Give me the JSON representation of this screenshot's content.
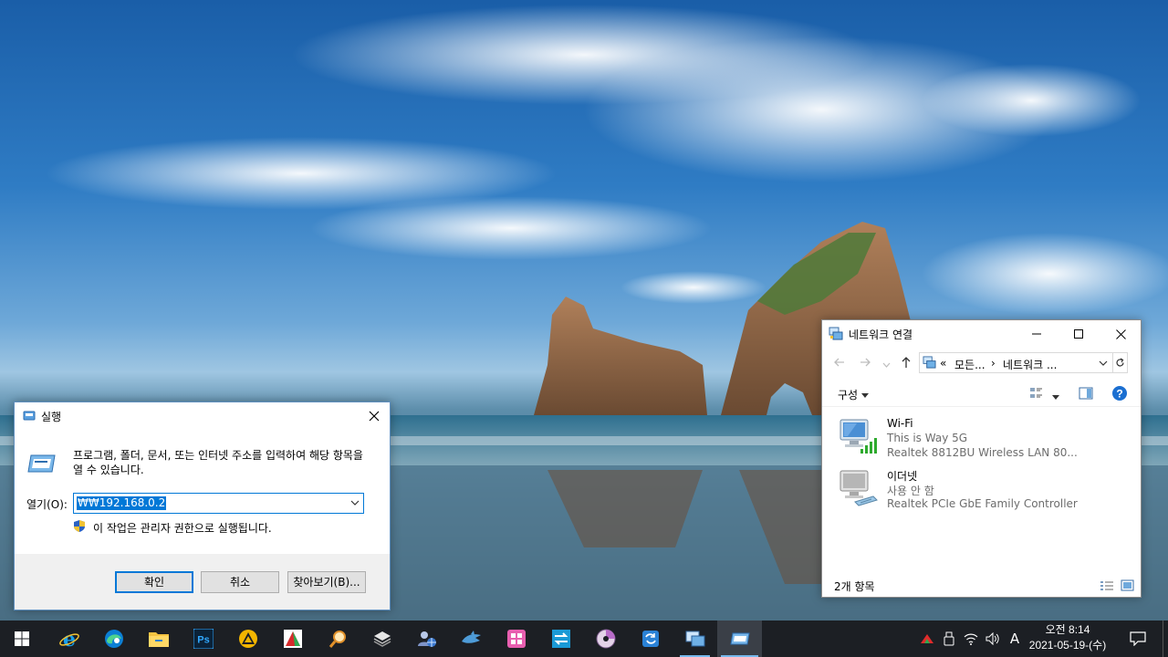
{
  "run_dialog": {
    "title": "실행",
    "description": "프로그램, 폴더, 문서, 또는 인터넷 주소를 입력하여 해당 항목을 열 수 있습니다.",
    "open_label": "열기(O):",
    "open_value": "₩₩192.168.0.2",
    "admin_note": "이 작업은 관리자 권한으로 실행됩니다.",
    "buttons": {
      "ok": "확인",
      "cancel": "취소",
      "browse": "찾아보기(B)..."
    }
  },
  "network_window": {
    "title": "네트워크 연결",
    "address": {
      "prefix": "«",
      "segment1": "모든...",
      "separator": "›",
      "segment2": "네트워크 ..."
    },
    "command_bar": {
      "organize": "구성"
    },
    "items": [
      {
        "name": "Wi-Fi",
        "status": "This is Way 5G",
        "adapter": "Realtek 8812BU Wireless LAN 80..."
      },
      {
        "name": "이더넷",
        "status": "사용 안 함",
        "adapter": "Realtek PCIe GbE Family Controller"
      }
    ],
    "status_bar": "2개 항목"
  },
  "taskbar": {
    "apps": [
      "internet-explorer",
      "edge",
      "file-explorer",
      "photoshop",
      "app-triangle",
      "app-red-green",
      "app-magnifier",
      "app-stack",
      "app-person-globe",
      "app-shark",
      "app-tiles",
      "app-arrows",
      "app-disc",
      "app-sync",
      "app-network-monitor",
      "app-run"
    ],
    "tray": {
      "ime": "A",
      "time": "오전 8:14",
      "date": "2021-05-19-(수)"
    }
  },
  "colors": {
    "accent": "#0078d7",
    "taskbar": "#1c1f24",
    "selection": "#0078d7"
  }
}
